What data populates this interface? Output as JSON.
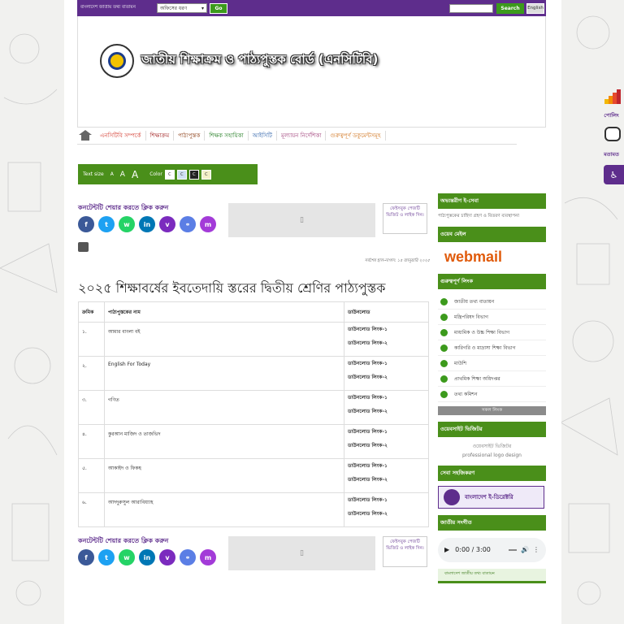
{
  "topbar": {
    "portal_text": "বাংলাদেশ জাতীয় তথ্য বাতায়ন",
    "office_select": "অফিসের ধরণ",
    "go": "Go",
    "search_placeholder": "",
    "search": "Search",
    "english": "English"
  },
  "banner": {
    "title": "জাতীয় শিক্ষাক্রম ও পাঠ্যপুস্তক বোর্ড (এনসিটিবি)"
  },
  "nav": [
    "এনসিটিবি সম্পর্কে",
    "শিক্ষাক্রম",
    "পাঠ্যপুস্তক",
    "শিক্ষক সহায়িকা",
    "আইসিটি",
    "মূল্যায়ন নির্দেশিকা",
    "গুরুত্বপূর্ণ ডকুমেন্টসমূহ"
  ],
  "textsize": {
    "label": "Text size",
    "a1": "A",
    "a2": "A",
    "a3": "A",
    "color_label": "Color",
    "c": "C"
  },
  "share": {
    "label": "কনটেন্টটি শেয়ার করতে ক্লিক করুন",
    "fb_text": "ফেইসবুক পেজটি ভিজিট ও লাইক দিন।",
    "icons": [
      "f",
      "t",
      "w",
      "in",
      "v",
      "⚭",
      "m"
    ]
  },
  "update_text": "সর্বশেষ হাল-নাগাদ: ১৫ জানুয়ারি ২০২৫",
  "page_title": "২০২৫ শিক্ষাবর্ষের ইবতেদায়ি স্তরের দ্বিতীয় শ্রেণির পাঠ্যপুস্তক",
  "table": {
    "headers": [
      "ক্রমিক",
      "পাঠ্যপুস্তকের নাম",
      "ডাউনলোড"
    ],
    "rows": [
      {
        "sl": "১.",
        "name": "আমার বাংলা বই",
        "d1": "ডাউনলোড লিংক-১",
        "d2": "ডাউনলোড লিংক-২"
      },
      {
        "sl": "২.",
        "name": "English For Today",
        "d1": "ডাউনলোড লিংক-১",
        "d2": "ডাউনলোড লিংক-২"
      },
      {
        "sl": "৩.",
        "name": "গণিত",
        "d1": "ডাউনলোড লিংক-১",
        "d2": "ডাউনলোড লিংক-২"
      },
      {
        "sl": "৪.",
        "name": "কুরআন মাজিদ ও তাজভিদ",
        "d1": "ডাউনলোড লিংক-১",
        "d2": "ডাউনলোড লিংক-২"
      },
      {
        "sl": "৫.",
        "name": "আকাইদ ও ফিকহ",
        "d1": "ডাউনলোড লিংক-১",
        "d2": "ডাউনলোড লিংক-২"
      },
      {
        "sl": "৬.",
        "name": "আদদুরুসুল আরাবিয়্যাহ",
        "d1": "ডাউনলোড লিংক-১",
        "d2": "ডাউনলোড লিংক-২"
      }
    ]
  },
  "sidebar": {
    "eservice_title": "অভ্যন্তরীণ ই-সেবা",
    "eservice_text": "পাঠ্যপুস্তকের চাহিদা গ্রহণ ও বিতরণ ব্যবস্থাপনা",
    "webmail_title": "ওয়েব মেইল",
    "webmail": "webmail",
    "links_title": "গুরুত্বপূর্ণ লিংক",
    "links": [
      "জাতীয় তথ্য বাতায়ন",
      "মন্ত্রিপরিষদ বিভাগ",
      "মাধ্যমিক ও উচ্চ শিক্ষা বিভাগ",
      "কারিগরি ও মাদ্রাসা শিক্ষা বিভাগ",
      "মাউশি",
      "প্রাথমিক শিক্ষা অধিদপ্তর",
      "তথ্য কমিশন"
    ],
    "all_links": "সকল লিংক",
    "visitor_title": "ওয়েবসাইট ভিজিটর",
    "visitor_alt": "ওয়েবসাইট ভিজিটর",
    "visitor_caption": "professional logo design",
    "service_title": "সেবা সহজিকরণ",
    "egov": "বাংলাদেশ ই-ডিরেক্টরি",
    "anthem_title": "জাতীয় সংগীত",
    "audio_time": "0:00 / 3:00",
    "strip_text": "বাংলাদেশ জাতীয় তথ্য বাতায়ন"
  },
  "right": {
    "poll": "পোলিং",
    "opinion": "মতামত"
  },
  "colors": {
    "purple": "#5e2d8c",
    "green": "#4a8f1a"
  }
}
